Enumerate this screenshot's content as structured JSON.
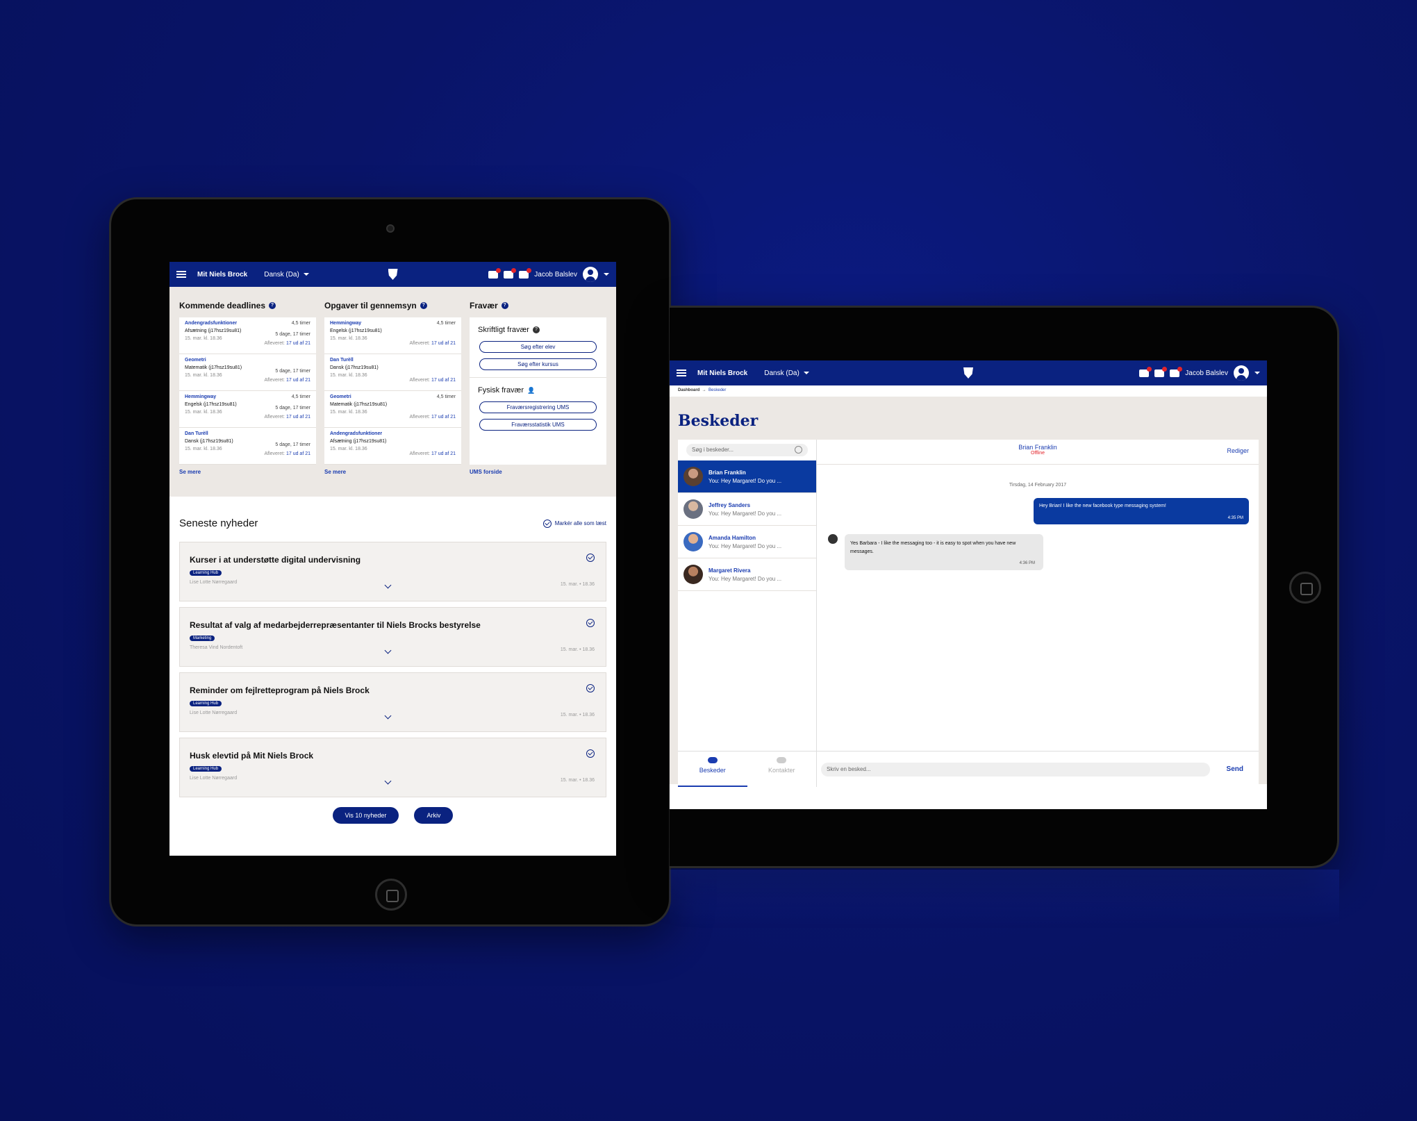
{
  "topbar": {
    "brand": "Mit Niels Brock",
    "language": "Dansk (Da)",
    "user": "Jacob Balslev"
  },
  "dashboard": {
    "deadlines": {
      "title": "Kommende deadlines",
      "more": "Se mere",
      "rows": [
        {
          "title": "Andengradsfunktioner",
          "subject": "Afsætning (j17hsz19su81)",
          "date": "15. mar. kl. 18.36",
          "time": "4,5 timer",
          "left": "5 dage, 17 timer",
          "delivered_label": "Afleveret:",
          "delivered": "17 ud af 21"
        },
        {
          "title": "Geometri",
          "subject": "Matematik (j17hsz19su81)",
          "date": "15. mar. kl. 18.36",
          "time": "",
          "left": "5 dage, 17 timer",
          "delivered_label": "Afleveret:",
          "delivered": "17 ud af 21"
        },
        {
          "title": "Hemmingway",
          "subject": "Engelsk (j17hsz19su81)",
          "date": "15. mar. kl. 18.36",
          "time": "4,5 timer",
          "left": "5 dage, 17 timer",
          "delivered_label": "Afleveret:",
          "delivered": "17 ud af 21"
        },
        {
          "title": "Dan Turèll",
          "subject": "Dansk (j17hsz19su81)",
          "date": "15. mar. kl. 18.36",
          "time": "",
          "left": "5 dage, 17 timer",
          "delivered_label": "Afleveret:",
          "delivered": "17 ud af 21"
        }
      ]
    },
    "review": {
      "title": "Opgaver til gennemsyn",
      "more": "Se mere",
      "rows": [
        {
          "title": "Hemmingway",
          "subject": "Engelsk (j17hsz19su81)",
          "date": "15. mar. kl. 18.36",
          "time": "4,5 timer",
          "delivered_label": "Afleveret:",
          "delivered": "17 ud af 21"
        },
        {
          "title": "Dan Turèll",
          "subject": "Dansk (j17hsz19su81)",
          "date": "15. mar. kl. 18.36",
          "time": "",
          "delivered_label": "Afleveret:",
          "delivered": "17 ud af 21"
        },
        {
          "title": "Geometri",
          "subject": "Matematik (j17hsz19su81)",
          "date": "15. mar. kl. 18.36",
          "time": "4,5 timer",
          "delivered_label": "Afleveret:",
          "delivered": "17 ud af 21"
        },
        {
          "title": "Andengradsfunktioner",
          "subject": "Afsætning (j17hsz19su81)",
          "date": "15. mar. kl. 18.36",
          "time": "",
          "delivered_label": "Afleveret:",
          "delivered": "17 ud af 21"
        }
      ]
    },
    "absence": {
      "title": "Fravær",
      "written": "Skriftligt fravær",
      "search_student": "Søg efter elev",
      "search_course": "Søg efter kursus",
      "physical": "Fysisk fravær",
      "reg": "Fraværsregistrering UMS",
      "stats": "Fraværsstatistik UMS",
      "more": "UMS forside"
    }
  },
  "news": {
    "title": "Seneste nyheder",
    "mark_all": "Markér alle som læst",
    "items": [
      {
        "title": "Kurser i at understøtte digital undervisning",
        "tag": "Learning Hub",
        "author": "Lise Lotte Nørregaard",
        "date": "15. mar. • 18.36"
      },
      {
        "title": "Resultat af valg af medarbejderrepræsentanter til Niels Brocks bestyrelse",
        "tag": "Marketing",
        "author": "Theresa Vind Nordentoft",
        "date": "15. mar. • 18.36"
      },
      {
        "title": "Reminder om fejlretteprogram på Niels Brock",
        "tag": "Learning Hub",
        "author": "Lise Lotte Nørregaard",
        "date": "15. mar. • 18.36"
      },
      {
        "title": "Husk elevtid på Mit Niels Brock",
        "tag": "Learning Hub",
        "author": "Lise Lotte Nørregaard",
        "date": "15. mar. • 18.36"
      }
    ],
    "show_btn": "Vis 10 nyheder",
    "archive_btn": "Arkiv"
  },
  "messages": {
    "crumb_home": "Dashboard",
    "crumb_current": "Beskeder",
    "title": "Beskeder",
    "search_placeholder": "Søg i beskeder...",
    "contacts": [
      {
        "name": "Brian Franklin",
        "preview": "You: Hey Margaret! Do you ..."
      },
      {
        "name": "Jeffrey Sanders",
        "preview": "You: Hey Margaret! Do you ..."
      },
      {
        "name": "Amanda Hamilton",
        "preview": "You: Hey Margaret! Do you ..."
      },
      {
        "name": "Margaret Rivera",
        "preview": "You: Hey Margaret! Do you ..."
      }
    ],
    "tab_messages": "Beskeder",
    "tab_contacts": "Kontakter",
    "chat": {
      "name": "Brian Franklin",
      "status": "Offline",
      "edit": "Rediger",
      "day": "Tirsdag, 14 February 2017",
      "out_text": "Hey Brian! I like the new facebook type messaging system!",
      "out_time": "4:35 PM",
      "in_text": "Yes Barbara - I like the messaging too - it is easy to spot when you have new messages.",
      "in_time": "4:36 PM",
      "compose_placeholder": "Skriv en besked...",
      "send": "Send"
    }
  }
}
